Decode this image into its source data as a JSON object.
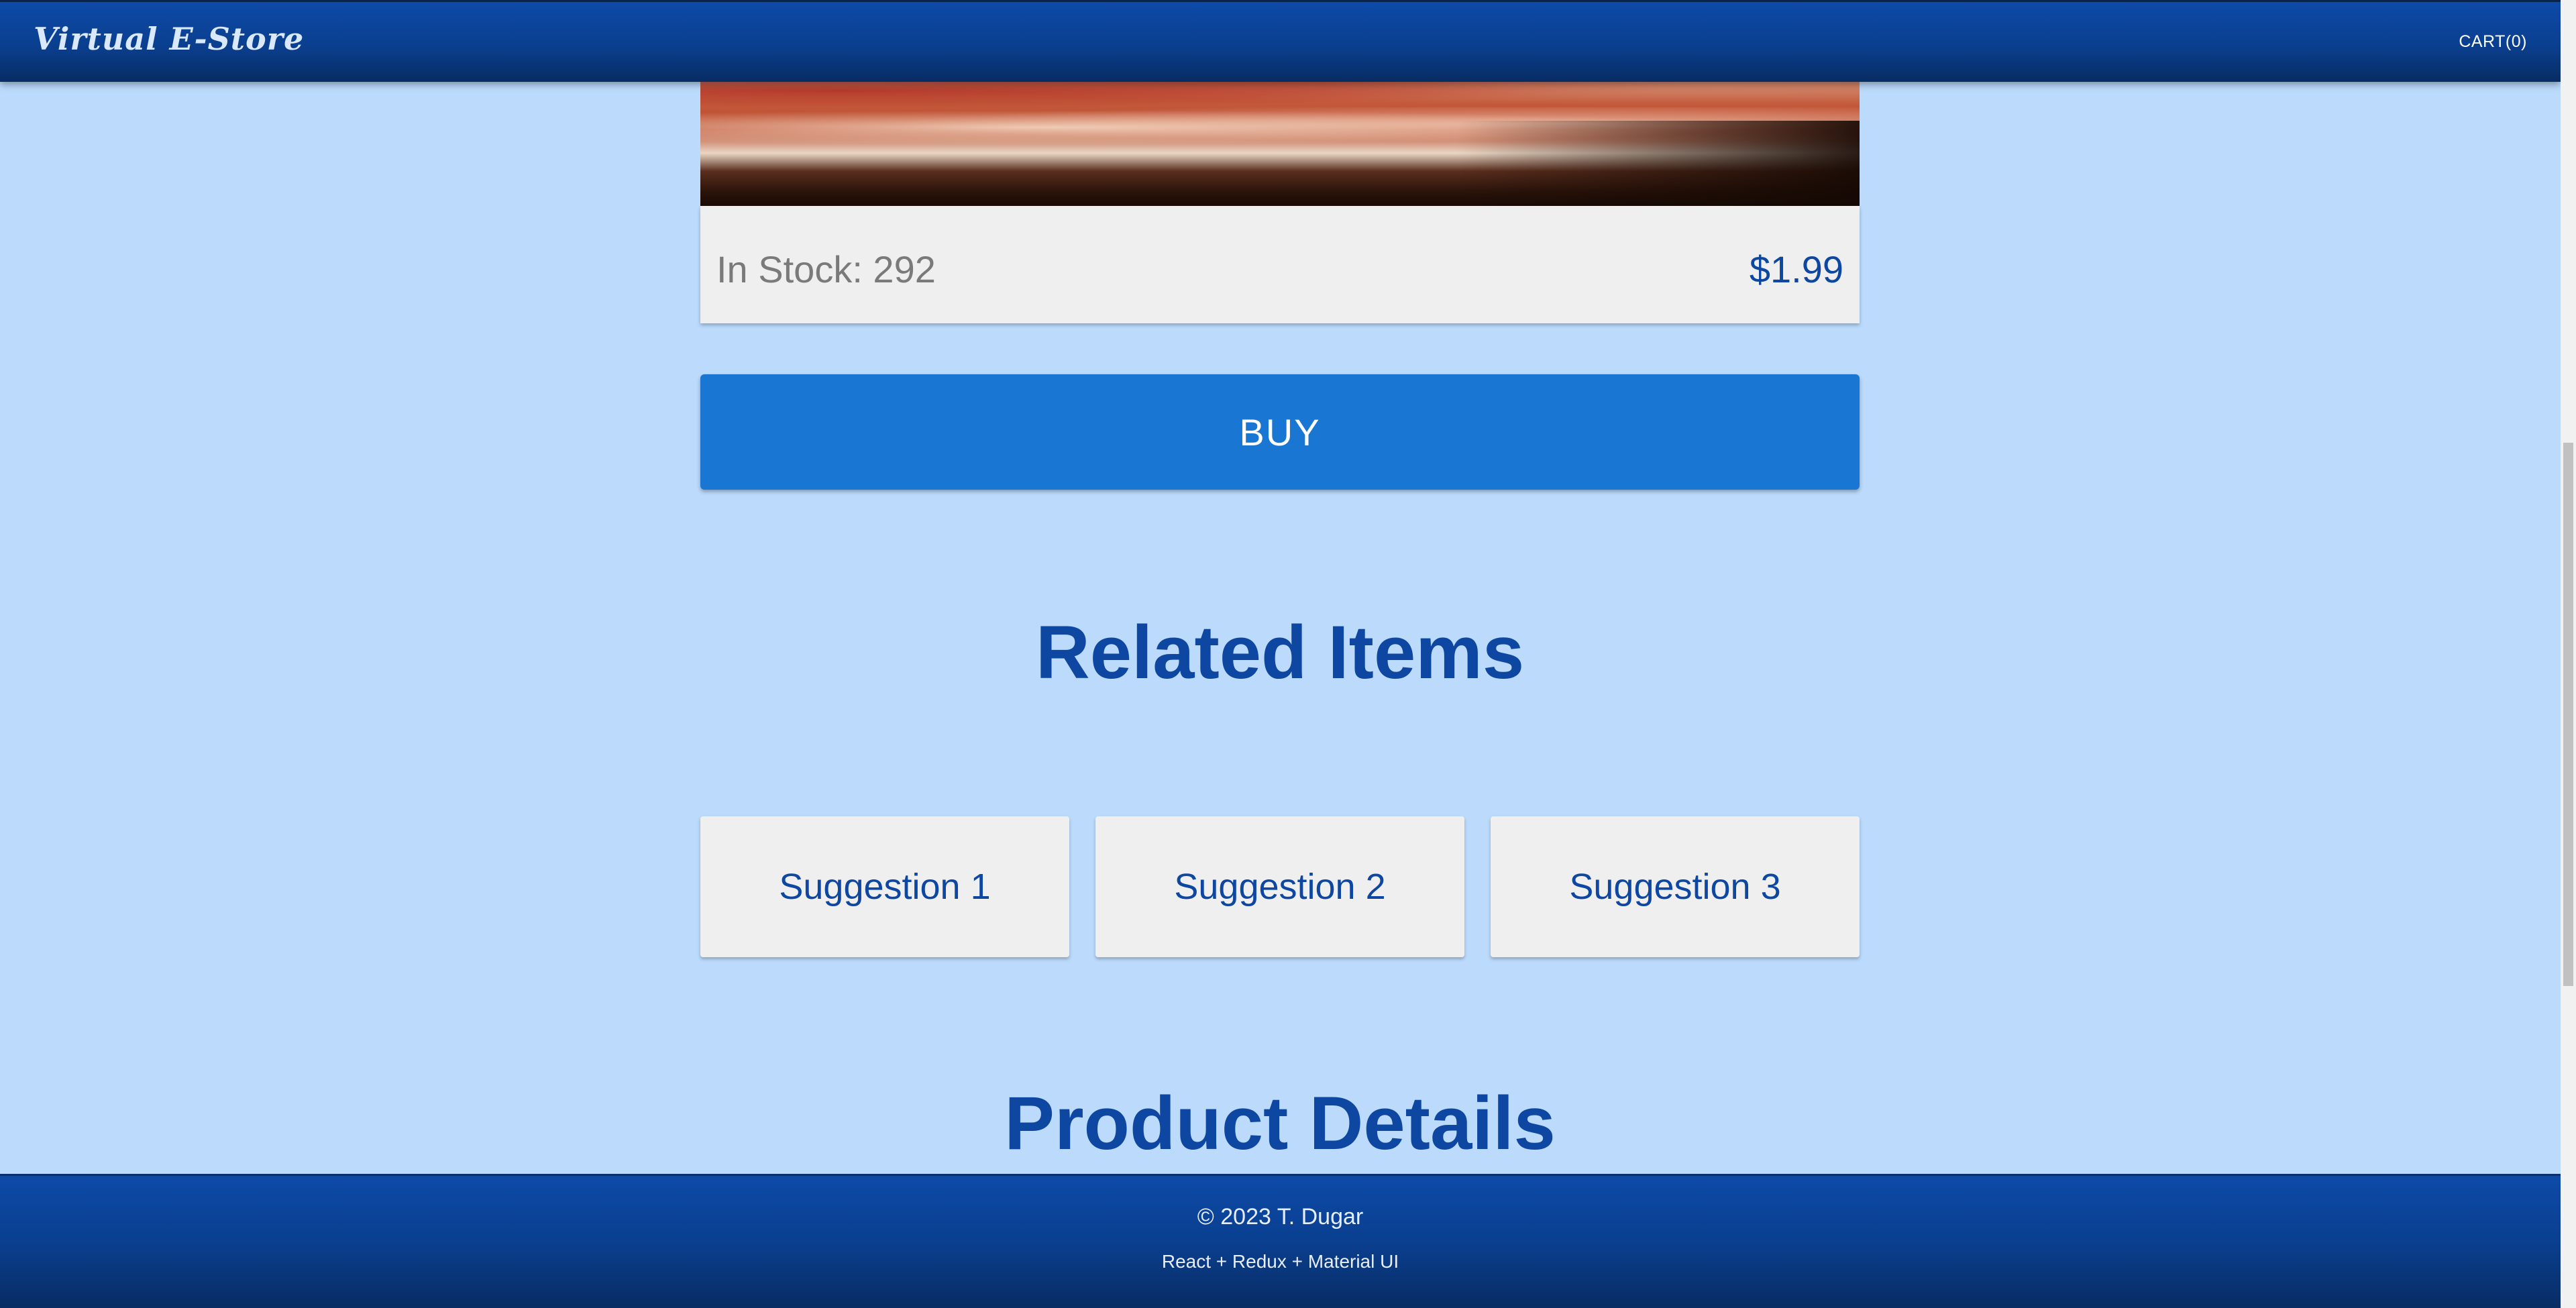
{
  "header": {
    "brand": "Virtual E-Store",
    "cart_label": "CART(0)"
  },
  "product": {
    "image_icon": "pizza-photo",
    "stock_text": "In Stock: 292",
    "price": "$1.99",
    "buy_label": "BUY"
  },
  "related": {
    "title": "Related Items",
    "suggestions": [
      {
        "label": "Suggestion 1"
      },
      {
        "label": "Suggestion 2"
      },
      {
        "label": "Suggestion 3"
      }
    ]
  },
  "details": {
    "title": "Product Details"
  },
  "footer": {
    "copyright": "© 2023 T. Dugar",
    "tech": "React + Redux + Material UI"
  },
  "colors": {
    "background": "#bbdafc",
    "appbar": "#0a3f8f",
    "accent": "#1976d2",
    "title": "#0d47a1",
    "card": "#efefef"
  }
}
